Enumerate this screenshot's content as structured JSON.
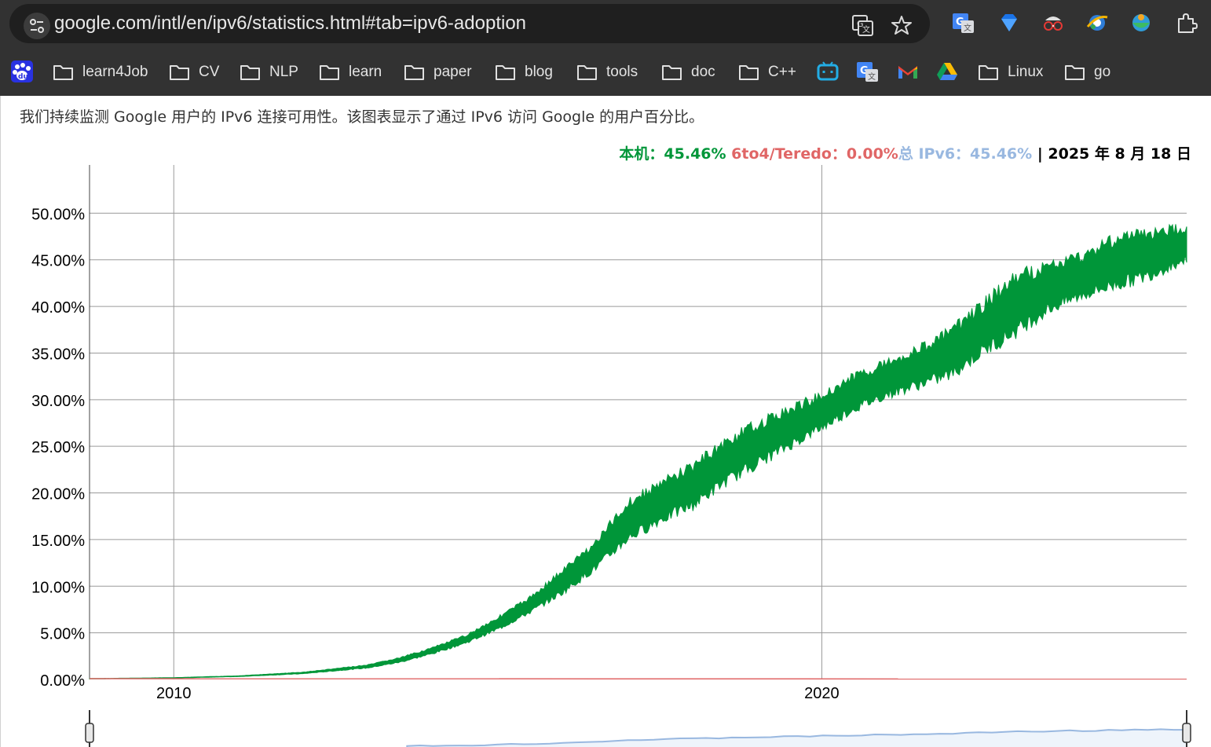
{
  "browser": {
    "url": "google.com/intl/en/ipv6/statistics.html#tab=ipv6-adoption",
    "url_icons": [
      "translate-icon",
      "star-icon"
    ],
    "extensions": [
      "google-translate-icon",
      "gem-icon",
      "spy-glasses-icon",
      "ie-icon",
      "globe-bowl-icon",
      "puzzle-icon"
    ]
  },
  "bookmarks": [
    {
      "type": "icon",
      "icon": "baidu-icon"
    },
    {
      "type": "folder",
      "label": "learn4Job"
    },
    {
      "type": "folder",
      "label": "CV"
    },
    {
      "type": "folder",
      "label": "NLP"
    },
    {
      "type": "folder",
      "label": "learn"
    },
    {
      "type": "folder",
      "label": "paper"
    },
    {
      "type": "folder",
      "label": "blog"
    },
    {
      "type": "folder",
      "label": "tools"
    },
    {
      "type": "folder",
      "label": "doc"
    },
    {
      "type": "folder",
      "label": "C++"
    },
    {
      "type": "icon",
      "icon": "bilibili-icon"
    },
    {
      "type": "icon",
      "icon": "google-translate-icon"
    },
    {
      "type": "icon",
      "icon": "gmail-icon"
    },
    {
      "type": "icon",
      "icon": "google-drive-icon"
    },
    {
      "type": "folder",
      "label": "Linux"
    },
    {
      "type": "folder",
      "label": "go"
    }
  ],
  "page": {
    "description": "我们持续监测 Google 用户的 IPv6 连接可用性。该图表显示了通过 IPv6 访问 Google 的用户百分比。",
    "legend": {
      "native_label": "本机：45.46%",
      "teredo_label": "6to4/Teredo：0.00%",
      "total_label": "总 IPv6：45.46%",
      "separator": " | ",
      "date_label": "2025 年 8 月 18 日"
    }
  },
  "colors": {
    "native": "#009639",
    "teredo": "#e06666",
    "total": "#99b8e0",
    "grid": "#9a9a9a"
  },
  "chart_data": {
    "type": "area",
    "x_unit": "year",
    "xlim": [
      2008.7,
      2025.63
    ],
    "ylim": [
      0,
      55
    ],
    "yticks": [
      0,
      5,
      10,
      15,
      20,
      25,
      30,
      35,
      40,
      45,
      50
    ],
    "ytick_labels": [
      "0.00%",
      "5.00%",
      "10.00%",
      "15.00%",
      "20.00%",
      "25.00%",
      "30.00%",
      "35.00%",
      "40.00%",
      "45.00%",
      "50.00%"
    ],
    "xticks": [
      2010,
      2020
    ],
    "xtick_labels": [
      "2010",
      "2020"
    ],
    "grid": true,
    "series": [
      {
        "name": "本机",
        "x": [
          2008.7,
          2010,
          2011,
          2012,
          2013,
          2013.5,
          2014,
          2014.5,
          2015,
          2015.5,
          2016,
          2016.5,
          2017,
          2017.5,
          2018,
          2018.5,
          2019,
          2019.5,
          2020,
          2020.5,
          2021,
          2021.5,
          2022,
          2022.5,
          2023,
          2023.5,
          2024,
          2024.5,
          2025,
          2025.63
        ],
        "high": [
          0.1,
          0.2,
          0.4,
          0.8,
          1.6,
          2.4,
          3.5,
          4.8,
          6.8,
          9.0,
          12.0,
          15.0,
          19.5,
          21.5,
          23.5,
          26.0,
          28.0,
          29.5,
          31.0,
          33.0,
          34.5,
          36.0,
          38.0,
          41.0,
          44.0,
          45.0,
          46.0,
          48.0,
          48.5,
          49.0
        ],
        "low": [
          0.05,
          0.15,
          0.3,
          0.6,
          1.2,
          1.8,
          2.7,
          3.8,
          5.2,
          7.0,
          9.0,
          11.5,
          14.5,
          16.5,
          18.0,
          20.5,
          22.5,
          24.5,
          26.5,
          28.5,
          30.0,
          31.0,
          32.0,
          34.5,
          36.5,
          39.0,
          40.5,
          41.5,
          42.5,
          44.5
        ]
      },
      {
        "name": "6to4/Teredo",
        "x": [
          2008.7,
          2025.63
        ],
        "values": [
          0.08,
          0.05
        ]
      }
    ]
  }
}
